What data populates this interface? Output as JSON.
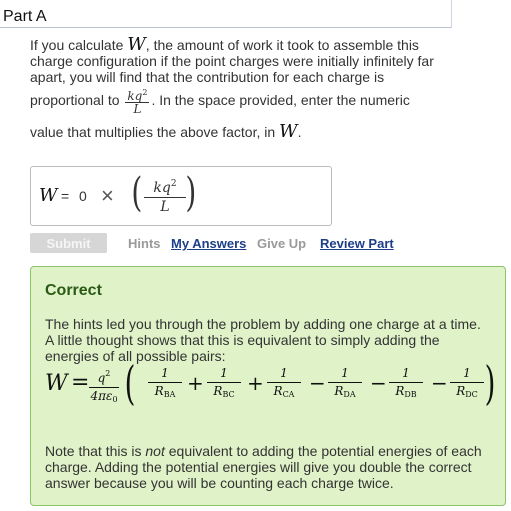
{
  "part": {
    "title": "Part A"
  },
  "question": {
    "line1_pre": "If you calculate ",
    "var_w": "W",
    "line1_post": ", the amount of work it took to assemble this",
    "line2": "charge configuration if the point charges were initially infinitely far",
    "line3": "apart, you will find that the contribution for each charge is",
    "line4_pre": "proportional to ",
    "factor_num": "kq",
    "factor_exp": "2",
    "factor_den": "L",
    "line4_post": ". In the space provided, enter the numeric",
    "line5_pre": "value that multiplies the above factor, in ",
    "line5_post": "."
  },
  "answer": {
    "var": "W",
    "equals": "=",
    "value": "0",
    "times": "×",
    "paren_open": "(",
    "paren_close": ")",
    "factor_num": "kq",
    "factor_exp": "2",
    "factor_den": "L"
  },
  "actions": {
    "submit": "Submit",
    "hints": "Hints",
    "my_answers": "My Answers",
    "give_up": "Give Up",
    "review_part": "Review Part"
  },
  "feedback": {
    "title": "Correct",
    "line1": "The hints led you through the problem by adding one charge at a time.",
    "line2": "A little thought shows that this is equivalent to simply adding the",
    "line3": "energies of all possible pairs:",
    "formula": {
      "lhs": "W",
      "equals": "=",
      "prefactor_num": "q",
      "prefactor_exp": "2",
      "prefactor_den": "4πε",
      "prefactor_den_sub": "0",
      "paren_open": "(",
      "paren_close": ")",
      "terms": [
        {
          "sign": "",
          "num": "1",
          "den": "R",
          "sub": "BA"
        },
        {
          "sign": "+",
          "num": "1",
          "den": "R",
          "sub": "BC"
        },
        {
          "sign": "+",
          "num": "1",
          "den": "R",
          "sub": "CA"
        },
        {
          "sign": "−",
          "num": "1",
          "den": "R",
          "sub": "DA"
        },
        {
          "sign": "−",
          "num": "1",
          "den": "R",
          "sub": "DB"
        },
        {
          "sign": "−",
          "num": "1",
          "den": "R",
          "sub": "DC"
        }
      ]
    },
    "note_pre": "Note that this is ",
    "note_em": "not",
    "note_line1_post": " equivalent to adding the potential energies of each",
    "note_line2": "charge. Adding the potential energies will give you double the correct",
    "note_line3": "answer because you will be counting each charge twice."
  },
  "colors": {
    "feedback_bg": "#dff2c8",
    "feedback_border": "#8cc46a",
    "feedback_title": "#2b5a16",
    "link": "#1d3f8a",
    "submit_disabled": "#d6d6d6"
  }
}
